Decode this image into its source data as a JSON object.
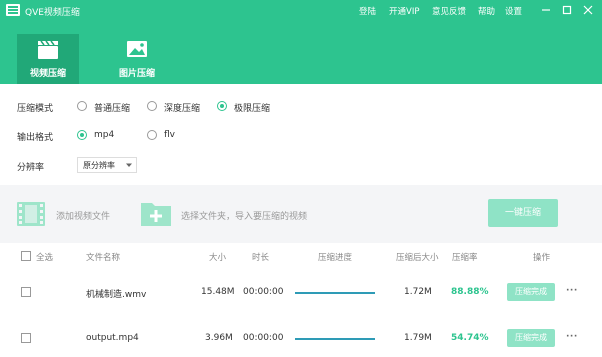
{
  "app": {
    "title": "QVE视频压缩",
    "menu": [
      "登陆",
      "开通VIP",
      "意见反馈",
      "帮助",
      "设置"
    ]
  },
  "tabs": [
    {
      "label": "视频压缩",
      "icon": "video-clapper-icon",
      "active": true
    },
    {
      "label": "图片压缩",
      "icon": "image-icon",
      "active": false
    }
  ],
  "options": {
    "compress_mode": {
      "label": "压缩模式",
      "choices": [
        "普通压缩",
        "深度压缩",
        "极限压缩"
      ],
      "selected": "极限压缩"
    },
    "output_format": {
      "label": "输出格式",
      "choices": [
        "mp4",
        "flv"
      ],
      "selected": "mp4"
    },
    "resolution": {
      "label": "分辨率",
      "value": "原分辨率"
    }
  },
  "add_bar": {
    "add_file": "添加视频文件",
    "add_folder": "选择文件夹，导入要压缩的视频",
    "compress_all": "一键压缩"
  },
  "table": {
    "headers": {
      "select_all": "全选",
      "name": "文件名称",
      "size": "大小",
      "duration": "时长",
      "progress": "压缩进度",
      "compressed_size": "压缩后大小",
      "ratio": "压缩率",
      "action": "操作"
    },
    "rows": [
      {
        "name": "机械制造.wmv",
        "size": "15.48M",
        "duration": "00:00:00",
        "progress": 1.0,
        "compressed_size": "1.72M",
        "ratio": "88.88%",
        "action": "压缩完成",
        "more": "···"
      },
      {
        "name": "output.mp4",
        "size": "3.96M",
        "duration": "00:00:00",
        "progress": 1.0,
        "compressed_size": "1.79M",
        "ratio": "54.74%",
        "action": "压缩完成",
        "more": "···"
      }
    ]
  },
  "colors": {
    "brand": "#2dc48f",
    "tab_active": "#21a878",
    "progress": "#2e9bb6",
    "button_light": "#8fe3c6"
  }
}
